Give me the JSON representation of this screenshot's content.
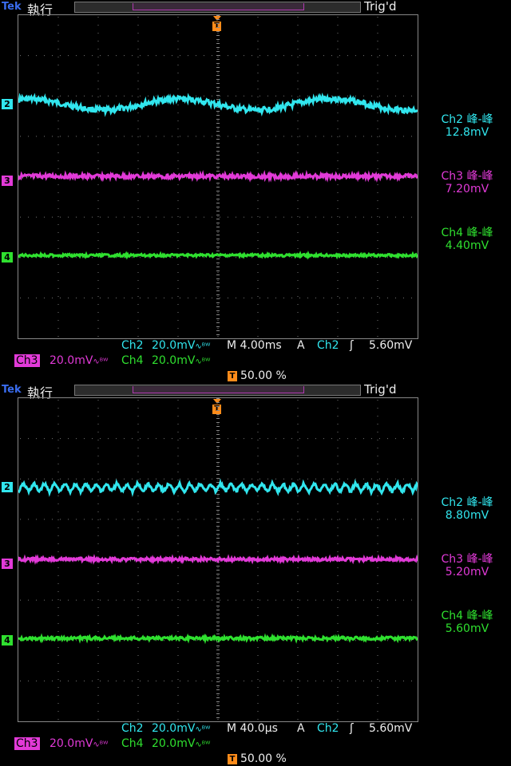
{
  "colors": {
    "ch2": "#31e6ee",
    "ch3": "#e23ad8",
    "ch4": "#2fe02f",
    "trigger": "#ff8c1a",
    "brand": "#3a6df0"
  },
  "panels": [
    {
      "brand": "Tek",
      "run_state": "執行",
      "trig_status": "Trig'd",
      "trigger_marker": "T",
      "channel_markers": [
        "2",
        "3",
        "4"
      ],
      "measurements": [
        {
          "label": "Ch2 峰-峰",
          "value": "12.8mV"
        },
        {
          "label": "Ch3 峰-峰",
          "value": "7.20mV"
        },
        {
          "label": "Ch4 峰-峰",
          "value": "4.40mV"
        }
      ],
      "status": {
        "ch2_label": "Ch2",
        "ch2_scale": "20.0mV",
        "ch3_label": "Ch3",
        "ch3_scale": "20.0mV",
        "ch4_label": "Ch4",
        "ch4_scale": "20.0mV",
        "bw_mark": "∿ᴮᵂ",
        "timebase": "M 4.00ms",
        "trigger_mode": "A",
        "trigger_source": "Ch2",
        "trigger_slope": "ʃ",
        "trigger_level": "5.60mV",
        "trigger_position": "50.00 %"
      }
    },
    {
      "brand": "Tek",
      "run_state": "執行",
      "trig_status": "Trig'd",
      "trigger_marker": "T",
      "channel_markers": [
        "2",
        "3",
        "4"
      ],
      "measurements": [
        {
          "label": "Ch2 峰-峰",
          "value": "8.80mV"
        },
        {
          "label": "Ch3 峰-峰",
          "value": "5.20mV"
        },
        {
          "label": "Ch4 峰-峰",
          "value": "5.60mV"
        }
      ],
      "status": {
        "ch2_label": "Ch2",
        "ch2_scale": "20.0mV",
        "ch3_label": "Ch3",
        "ch3_scale": "20.0mV",
        "ch4_label": "Ch4",
        "ch4_scale": "20.0mV",
        "bw_mark": "∿ᴮᵂ",
        "timebase": "M 40.0µs",
        "trigger_mode": "A",
        "trigger_source": "Ch2",
        "trigger_slope": "ʃ",
        "trigger_level": "5.60mV",
        "trigger_position": "50.00 %"
      }
    }
  ]
}
